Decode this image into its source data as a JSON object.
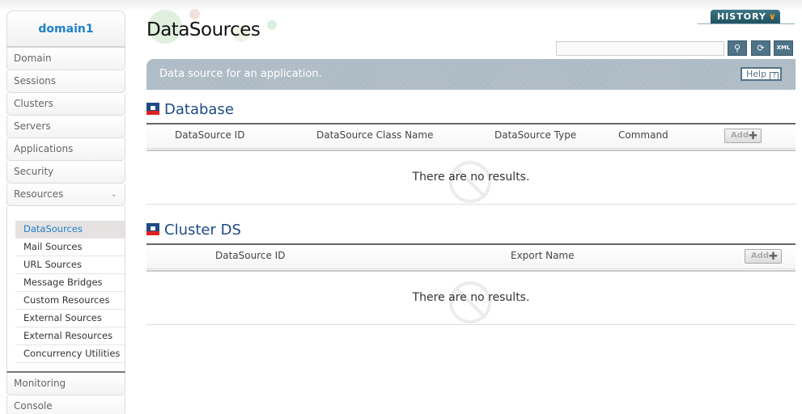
{
  "sidebar": {
    "domain": "domain1",
    "items": [
      {
        "label": "Domain"
      },
      {
        "label": "Sessions"
      },
      {
        "label": "Clusters"
      },
      {
        "label": "Servers"
      },
      {
        "label": "Applications"
      },
      {
        "label": "Security"
      },
      {
        "label": "Resources",
        "expanded": true
      }
    ],
    "submenu": [
      {
        "label": "DataSources",
        "active": true
      },
      {
        "label": "Mail Sources"
      },
      {
        "label": "URL Sources"
      },
      {
        "label": "Message Bridges"
      },
      {
        "label": "Custom Resources"
      },
      {
        "label": "External Sources"
      },
      {
        "label": "External Resources"
      },
      {
        "label": "Concurrency Utilities"
      }
    ],
    "bottom_items": [
      {
        "label": "Monitoring"
      },
      {
        "label": "Console"
      }
    ]
  },
  "header": {
    "title": "DataSources",
    "history_label": "HISTORY",
    "search": {
      "value": "",
      "placeholder": ""
    },
    "tools": [
      {
        "icon": "search-icon",
        "glyph": "🔍"
      },
      {
        "icon": "refresh-icon",
        "glyph": "⟳"
      },
      {
        "icon": "xml-export-icon",
        "glyph": "XML"
      }
    ]
  },
  "banner": {
    "description": "Data source for an application.",
    "help_label": "Help",
    "help_glyph": "?"
  },
  "sections": {
    "database": {
      "title": "Database",
      "columns": [
        "DataSource ID",
        "DataSource Class Name",
        "DataSource Type",
        "Command"
      ],
      "add_label": "Add",
      "empty_text": "There are no results."
    },
    "cluster_ds": {
      "title": "Cluster DS",
      "columns": [
        "DataSource ID",
        "Export Name"
      ],
      "add_label": "Add",
      "empty_text": "There are no results."
    }
  }
}
